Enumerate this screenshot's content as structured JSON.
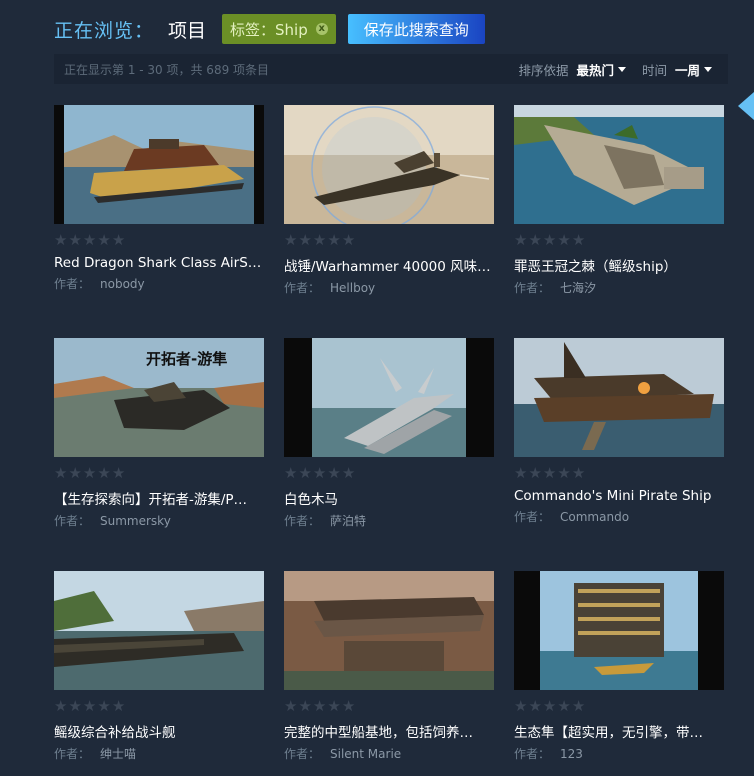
{
  "header": {
    "browsing_label": "正在浏览：",
    "browsing_value": "项目",
    "tag_label": "标签：Ship",
    "tag_remove": "x",
    "save_button": "保存此搜索查询"
  },
  "infobar": {
    "count_text": "正在显示第 1 - 30 项，共 689 项条目",
    "sort_label": "排序依据",
    "sort_value": "最热门",
    "time_label": "时间",
    "time_value": "一周"
  },
  "items": [
    {
      "title": "Red Dragon Shark Class AirS…",
      "author_label": "作者：",
      "author": "nobody",
      "rating_stars": 0
    },
    {
      "title": "战锤/Warhammer 40000 风味…",
      "author_label": "作者：",
      "author": "Hellboy",
      "rating_stars": 0
    },
    {
      "title": "罪恶王冠之棘（鳐级ship）",
      "author_label": "作者：",
      "author": "七海汐",
      "rating_stars": 0
    },
    {
      "title": "【生存探索向】开拓者-游集/P…",
      "author_label": "作者：",
      "author": "Summersky",
      "rating_stars": 0,
      "thumb_caption": "开拓者-游隼"
    },
    {
      "title": "白色木马",
      "author_label": "作者：",
      "author": "萨泊特",
      "rating_stars": 0
    },
    {
      "title": "Commando's Mini Pirate Ship",
      "author_label": "作者：",
      "author": "Commando",
      "rating_stars": 0
    },
    {
      "title": "鳐级综合补给战斗舰",
      "author_label": "作者：",
      "author": "绅士喵",
      "rating_stars": 0
    },
    {
      "title": "完整的中型船基地，包括饲养…",
      "author_label": "作者：",
      "author": "Silent Marie",
      "rating_stars": 0
    },
    {
      "title": "生态隼【超实用，无引擎，带…",
      "author_label": "作者：",
      "author": "123",
      "rating_stars": 0
    }
  ]
}
